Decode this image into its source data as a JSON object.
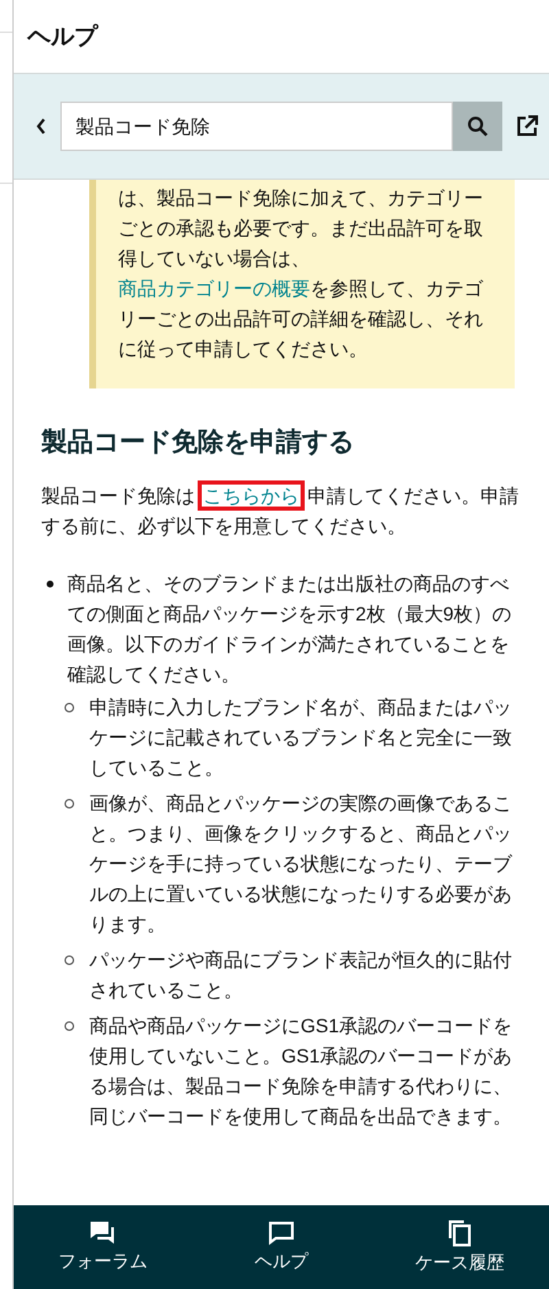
{
  "panel": {
    "title": "ヘルプ"
  },
  "search": {
    "value": "製品コード免除"
  },
  "note": {
    "before": "は、製品コード免除に加えて、カテゴリーごとの承認も必要です。まだ出品許可を取得していない場合は、",
    "link": "商品カテゴリーの概要",
    "after": "を参照して、カテゴリーごとの出品許可の詳細を確認し、それに従って申請してください。"
  },
  "heading": "製品コード免除を申請する",
  "intro": {
    "before": "製品コード免除は",
    "link": "こちらから",
    "link_highlighted": true,
    "after": "申請してください。申請する前に、必ず以下を用意してください。"
  },
  "bullets": [
    {
      "text": "商品名と、そのブランドまたは出版社の商品のすべての側面と商品パッケージを示す2枚（最大9枚）の画像。以下のガイドラインが満たされていることを確認してください。",
      "children": [
        {
          "text": "申請時に入力したブランド名が、商品またはパッケージに記載されているブランド名と完全に一致していること。"
        },
        {
          "text": "画像が、商品とパッケージの実際の画像であること。つまり、画像をクリックすると、商品とパッケージを手に持っている状態になったり、テーブルの上に置いている状態になったりする必要があります。"
        },
        {
          "text": "パッケージや商品にブランド表記が恒久的に貼付されていること。"
        },
        {
          "text": "商品や商品パッケージにGS1承認のバーコードを使用していないこと。GS1承認のバーコードがある場合は、製品コード免除を申請する代わりに、同じバーコードを使用して商品を出品できます。"
        }
      ]
    }
  ],
  "bottom_nav": [
    {
      "kind": "forum",
      "label": "フォーラム"
    },
    {
      "kind": "help",
      "label": "ヘルプ"
    },
    {
      "kind": "cases",
      "label": "ケース履歴"
    }
  ]
}
